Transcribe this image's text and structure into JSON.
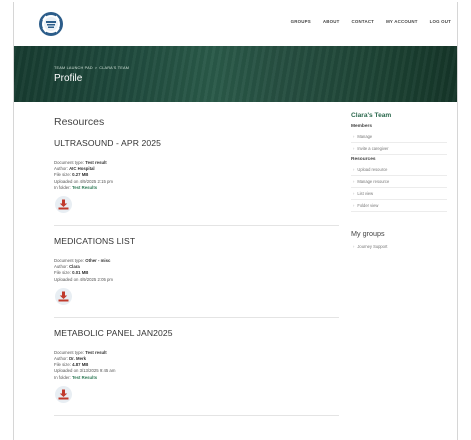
{
  "header": {
    "logo_alt": "Team Launch Pad",
    "nav": [
      "GROUPS",
      "ABOUT",
      "CONTACT",
      "MY ACCOUNT",
      "LOG OUT"
    ]
  },
  "hero": {
    "breadcrumb": [
      "TEAM LAUNCH PAD",
      ">",
      "CLARA'S TEAM"
    ],
    "title": "Profile"
  },
  "main": {
    "section_title": "Resources",
    "documents": [
      {
        "title": "ULTRASOUND - APR 2025",
        "type_label": "Document type:",
        "type": "Test result",
        "author_label": "Author:",
        "author": "AIC Hospital",
        "size_label": "File size:",
        "size": "0.27 MB",
        "uploaded": "Uploaded on 4/9/2025 2:15 pm",
        "folder_label": "In folder:",
        "folder": "Test Results"
      },
      {
        "title": "MEDICATIONS LIST",
        "type_label": "Document type:",
        "type": "Other - misc",
        "author_label": "Author:",
        "author": "Clara",
        "size_label": "File size:",
        "size": "0.01 MB",
        "uploaded": "Uploaded on 4/9/2025 2:05 pm"
      },
      {
        "title": "METABOLIC PANEL JAN2025",
        "type_label": "Document type:",
        "type": "Test result",
        "author_label": "Author:",
        "author": "Dr. Merk",
        "size_label": "File size:",
        "size": "4.87 MB",
        "uploaded": "Uploaded on 3/13/2025 9:45 am",
        "folder_label": "In folder:",
        "folder": "Test Results"
      }
    ]
  },
  "sidebar": {
    "team_title": "Clara's Team",
    "members_heading": "Members",
    "members_items": [
      "Manage",
      "Invite a caregiver"
    ],
    "resources_heading": "Resources",
    "resources_items": [
      "Upload resource",
      "Manage resource",
      "List view",
      "Folder view"
    ],
    "groups_title": "My groups",
    "groups_items": [
      "Journey Support"
    ]
  },
  "colors": {
    "accent_green": "#2d6a4f",
    "hero_dark": "#173b30",
    "download_red": "#c0392b"
  }
}
